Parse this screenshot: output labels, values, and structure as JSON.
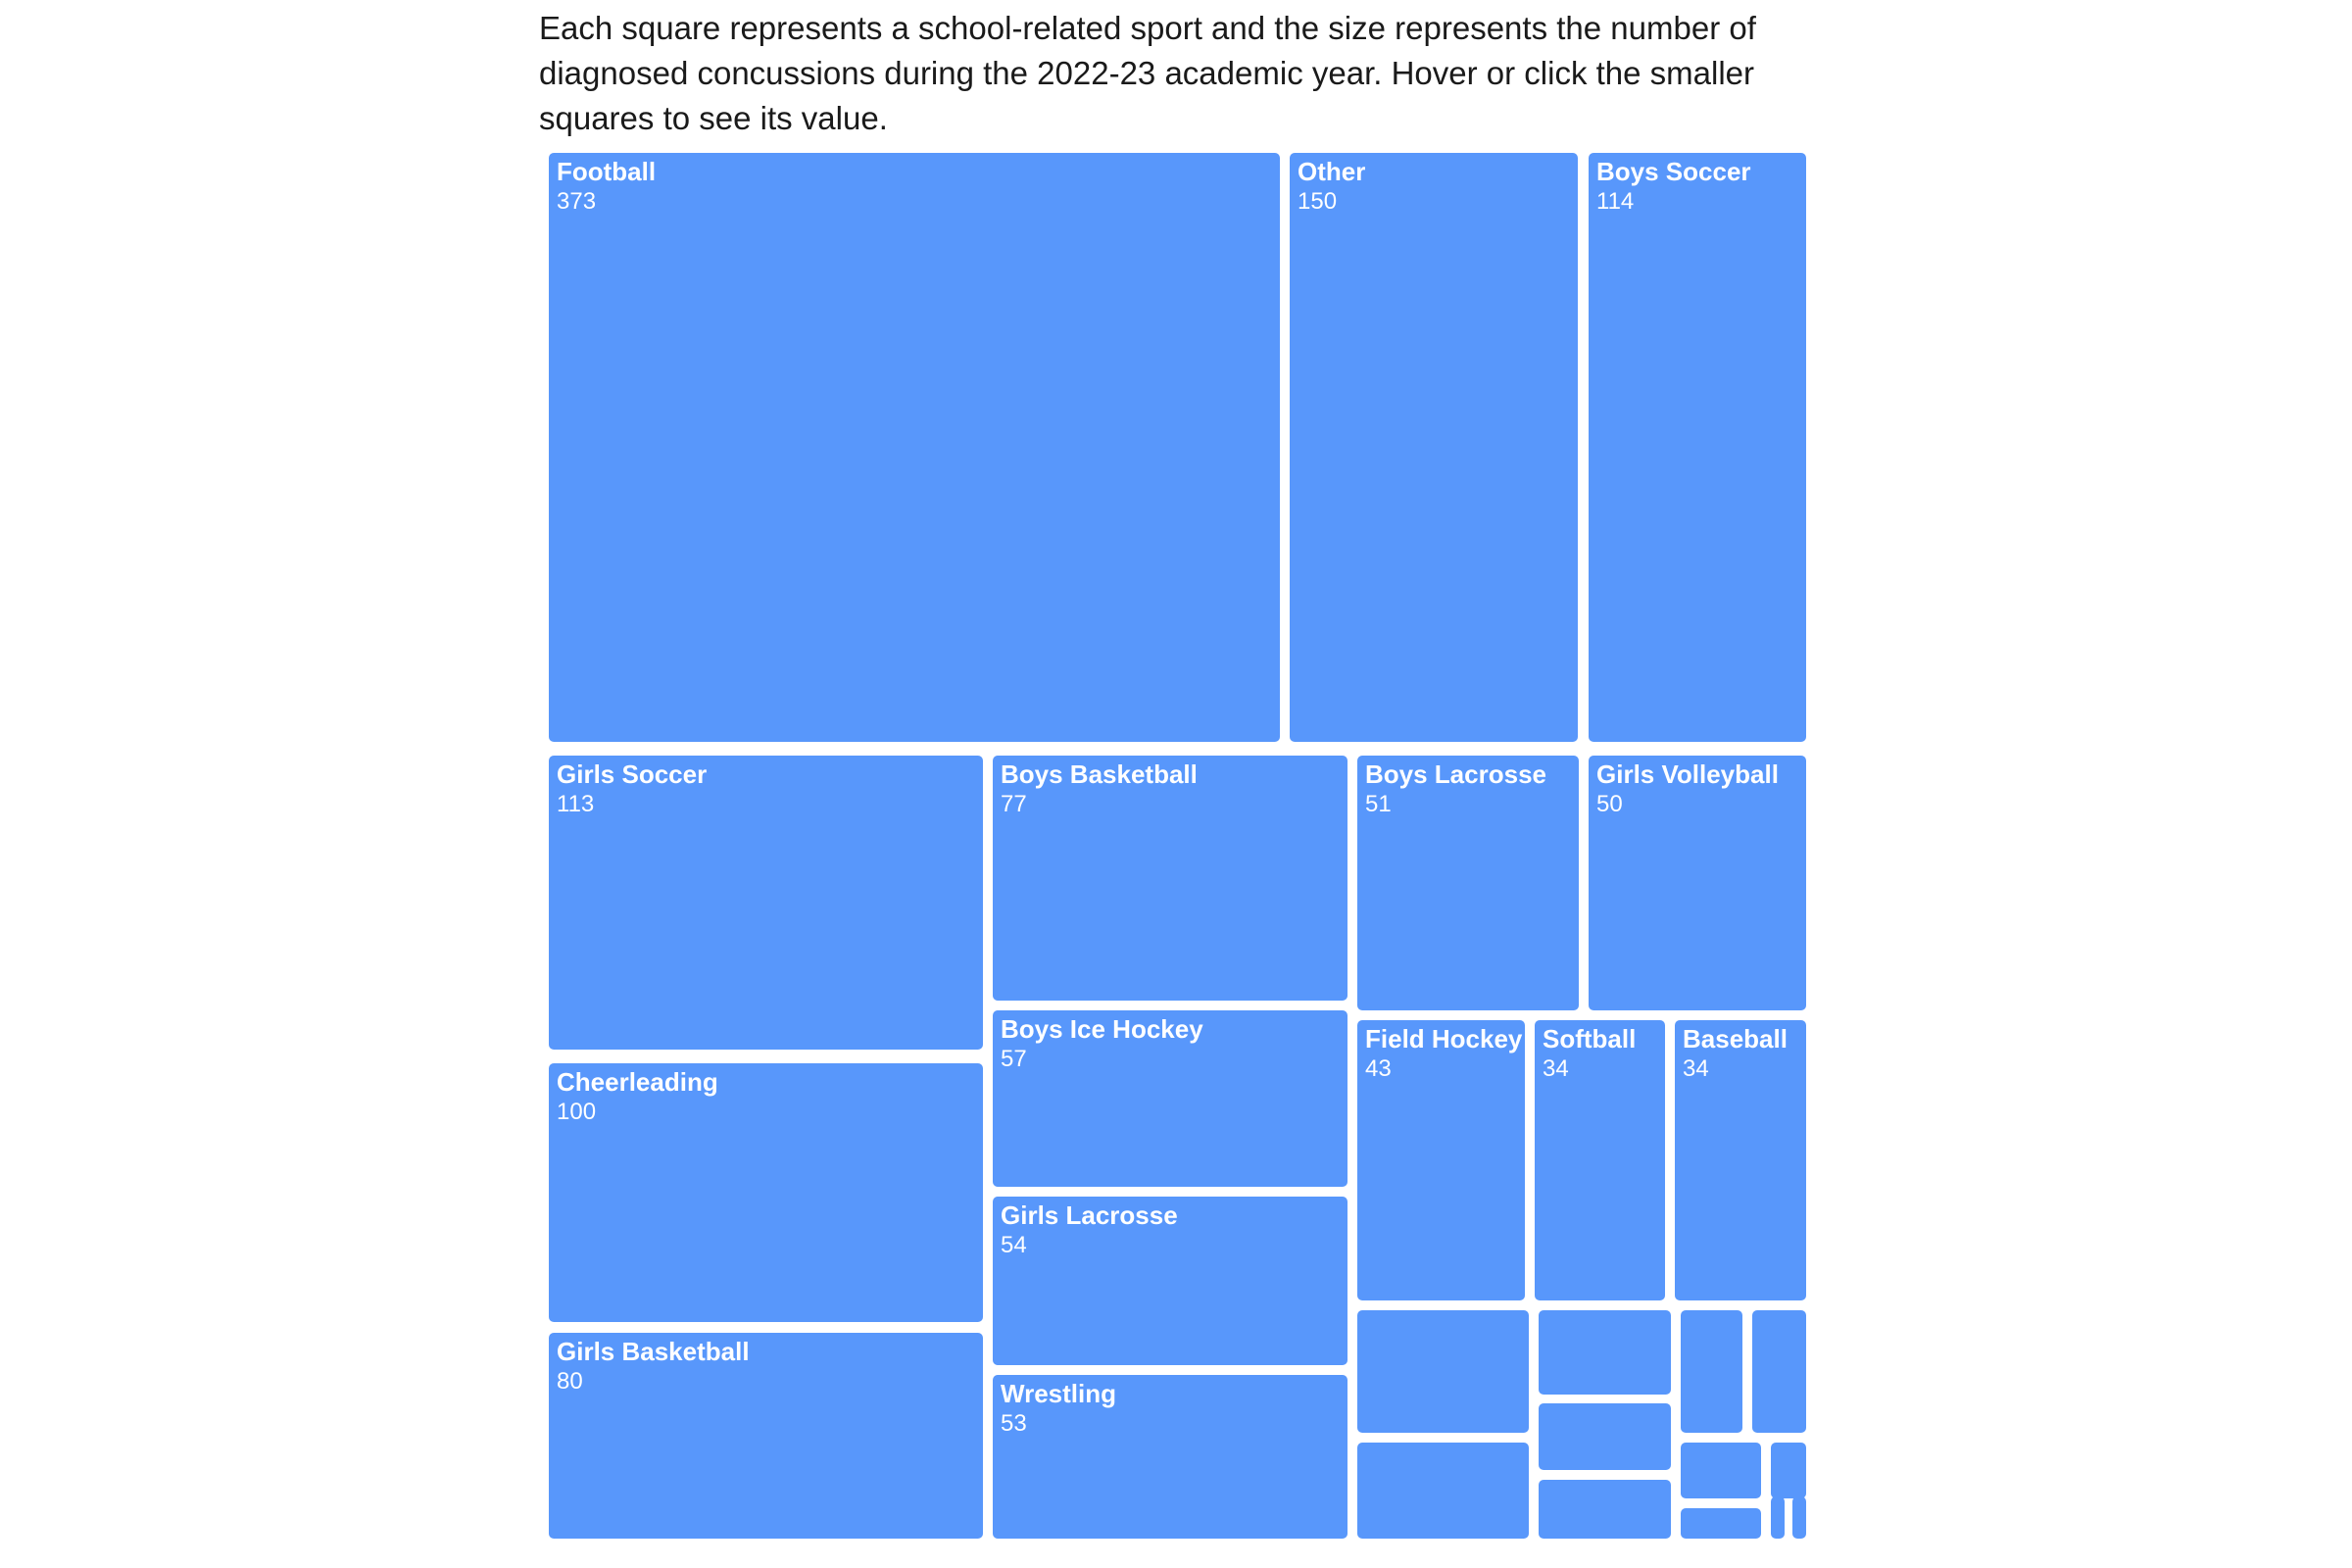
{
  "description": "Each square represents a school-related sport and the size represents the number of diagnosed concussions during the 2022-23 academic year. Hover or click the smaller squares to see its value.",
  "colors": {
    "tile": "#5897fb",
    "label": "#ffffff",
    "text": "#1a1a1a"
  },
  "chart_data": {
    "type": "treemap",
    "title": "",
    "unit": "diagnosed concussions",
    "items": [
      {
        "name": "Football",
        "value": 373
      },
      {
        "name": "Other",
        "value": 150
      },
      {
        "name": "Boys Soccer",
        "value": 114
      },
      {
        "name": "Girls Soccer",
        "value": 113
      },
      {
        "name": "Cheerleading",
        "value": 100
      },
      {
        "name": "Girls Basketball",
        "value": 80
      },
      {
        "name": "Boys Basketball",
        "value": 77
      },
      {
        "name": "Boys Ice Hockey",
        "value": 57
      },
      {
        "name": "Girls Lacrosse",
        "value": 54
      },
      {
        "name": "Wrestling",
        "value": 53
      },
      {
        "name": "Boys Lacrosse",
        "value": 51
      },
      {
        "name": "Girls Volleyball",
        "value": 50
      },
      {
        "name": "Field Hockey",
        "value": 43
      },
      {
        "name": "Softball",
        "value": 34
      },
      {
        "name": "Baseball",
        "value": 34
      },
      {
        "name": "",
        "value": null
      },
      {
        "name": "",
        "value": null
      },
      {
        "name": "",
        "value": null
      },
      {
        "name": "",
        "value": null
      },
      {
        "name": "",
        "value": null
      },
      {
        "name": "",
        "value": null
      },
      {
        "name": "",
        "value": null
      },
      {
        "name": "",
        "value": null
      },
      {
        "name": "",
        "value": null
      },
      {
        "name": "",
        "value": null
      },
      {
        "name": "",
        "value": null
      },
      {
        "name": "",
        "value": null
      }
    ]
  }
}
